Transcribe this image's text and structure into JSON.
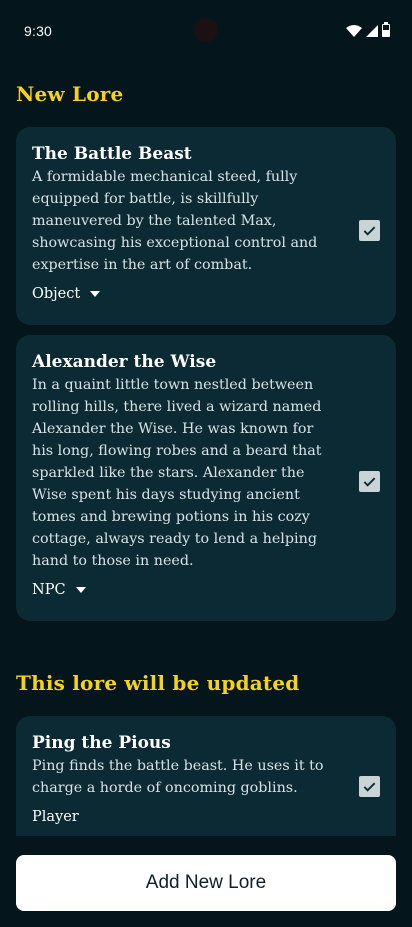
{
  "status_bar": {
    "time": "9:30"
  },
  "new_lore": {
    "title": "New Lore",
    "items": [
      {
        "name": "The Battle Beast",
        "description": "A formidable mechanical steed, fully equipped for battle, is skillfully maneuvered by the talented Max, showcasing his exceptional control and expertise in the art of combat.",
        "type": "Object",
        "checked": true
      },
      {
        "name": "Alexander the Wise",
        "description": "In a quaint little town nestled between rolling hills, there lived a wizard named Alexander the Wise. He was known for his long, flowing robes and a beard that sparkled like the stars. Alexander the Wise spent his days studying ancient tomes and brewing potions in his cozy cottage, always ready to lend a helping hand to those in need.",
        "type": "NPC",
        "checked": true
      }
    ]
  },
  "updated_lore": {
    "title": "This lore will be updated",
    "items": [
      {
        "name": "Ping the Pious",
        "description": "Ping finds the battle beast. He uses it to charge a horde of oncoming goblins.",
        "type": "Player",
        "checked": true
      }
    ]
  },
  "actions": {
    "add_label": "Add New Lore"
  }
}
